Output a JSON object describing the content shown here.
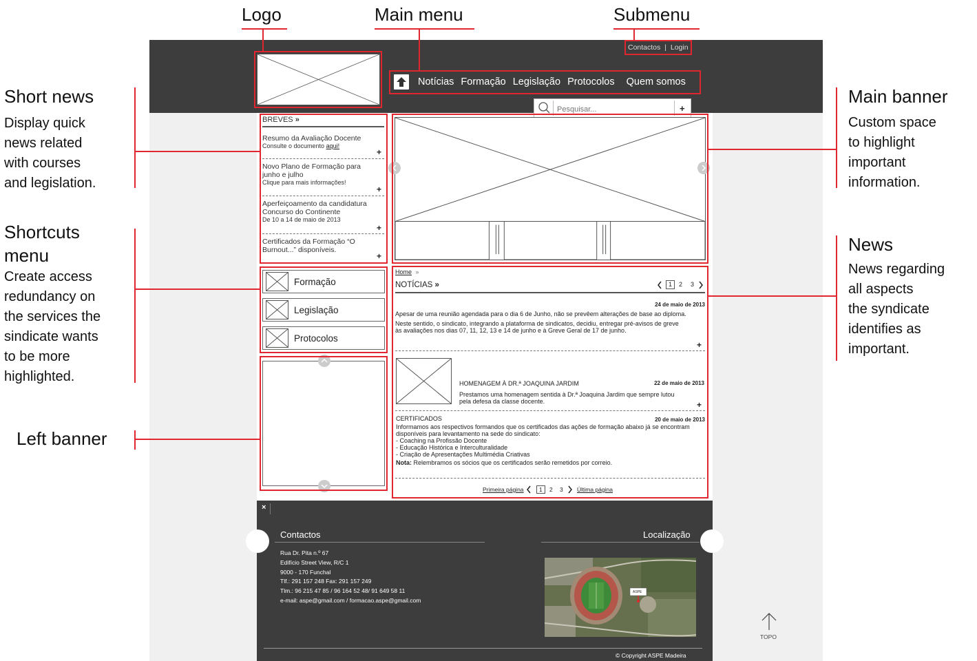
{
  "annotations": {
    "logo": "Logo",
    "main_menu": "Main menu",
    "submenu": "Submenu",
    "short_news_title": "Short news",
    "short_news_desc": [
      "Display quick",
      "news related",
      "with courses",
      "and legislation."
    ],
    "shortcuts_title": [
      "Shortcuts",
      "menu"
    ],
    "shortcuts_desc": [
      "Create access",
      "redundancy on",
      "the services the",
      "sindicate wants",
      "to be more",
      "highlighted."
    ],
    "left_banner": "Left banner",
    "main_banner_title": "Main banner",
    "main_banner_desc": [
      "Custom space",
      "to highlight",
      "important",
      "information."
    ],
    "news_title": "News",
    "news_desc": [
      "News regarding",
      "all aspects",
      "the syndicate",
      "identifies as",
      "important."
    ]
  },
  "header": {
    "submenu": {
      "contacts": "Contactos",
      "sep": "|",
      "login": "Login"
    },
    "nav": [
      "Notícias",
      "Formação",
      "Legislação",
      "Protocolos",
      "Quem somos"
    ],
    "search_placeholder": "Pesquisar...",
    "search_plus": "+"
  },
  "breves": {
    "title": "BREVES",
    "chevrons": "»",
    "items": [
      {
        "title": [
          "Resumo da Avaliação Docente"
        ],
        "sub_prefix": "Consulte o documento ",
        "sub_link": "aqui!"
      },
      {
        "title": [
          "Novo Plano de Formação para",
          "junho e julho"
        ],
        "sub_prefix": "Clique para mais informações!",
        "sub_link": ""
      },
      {
        "title": [
          "Aperfeiçoamento da candidatura",
          "Concurso do Continente"
        ],
        "sub_prefix": "De 10 a 14 de maio de 2013",
        "sub_link": ""
      },
      {
        "title": [
          "Certificados da Formação “O",
          "Burnout...” disponíveis."
        ],
        "sub_prefix": "",
        "sub_link": ""
      }
    ],
    "plus": "+"
  },
  "shortcuts": [
    "Formação",
    "Legislação",
    "Protocolos"
  ],
  "news": {
    "breadcrumb_home": "Home",
    "breadcrumb_chev": "»",
    "title": "NOTÍCIAS",
    "title_chev": "»",
    "pages": [
      "1",
      "2",
      "3"
    ],
    "items": {
      "first": {
        "date": "24 de maio de 2013",
        "p1": "Apesar de uma reunião agendada para o dia 6 de Junho, não se prevêem alterações de base ao diploma.",
        "p2": [
          "Neste sentido, o sindicato, integrando a plataforma de sindicatos, decidiu, entregar pré-avisos de greve",
          "às avaliações nos dias 07, 11, 12, 13 e 14 de junho e à Greve Geral de 17 de junho."
        ]
      },
      "second": {
        "title": "HOMENAGEM À DR.ª JOAQUINA JARDIM",
        "date": "22 de maio de 2013",
        "body": [
          "Prestamos uma homenagem sentida à Dr.ª Joaquina Jardim que sempre lutou",
          "pela defesa da classe docente."
        ]
      },
      "third": {
        "title": "CERTIFICADOS",
        "date": "20 de maio de 2013",
        "body": [
          "Informamos aos respectivos formandos que os certificados das ações de formação abaixo já se encontram",
          "disponíveis para levantamento na sede do sindicato:",
          "- Coaching na Profissão Docente",
          "- Educação Histórica e Interculturalidade",
          "- Criação de Apresentações Multimédia Criativas"
        ],
        "note_label": "Nota:",
        "note_text": " Relembramos os sócios que os certificados serão remetidos por correio."
      }
    },
    "pager": {
      "first": "Primeira página",
      "last": "Última página",
      "pages": [
        "1",
        "2",
        "3"
      ]
    }
  },
  "footer": {
    "close": "×",
    "contacts_title": "Contactos",
    "contacts_lines": [
      "Rua Dr. Pita n.º 67",
      "Edifício Street View, R/C 1",
      "9000 - 170 Funchal",
      "Tlf.: 291 157 248 Fax: 291 157 249",
      "Tlm.: 96 215 47 85 / 96 164 52 48/ 91 649 58 11",
      "e-mail: aspe@gmail.com / formacao.aspe@gmail.com"
    ],
    "location_title": "Localização",
    "map_pin": "ASPE",
    "copyright": "© Copyright ASPE Madeira",
    "topo": "TOPO"
  },
  "colors": {
    "accent": "#e0262f",
    "dark": "#3d3d3d",
    "light_bg": "#efefef"
  }
}
